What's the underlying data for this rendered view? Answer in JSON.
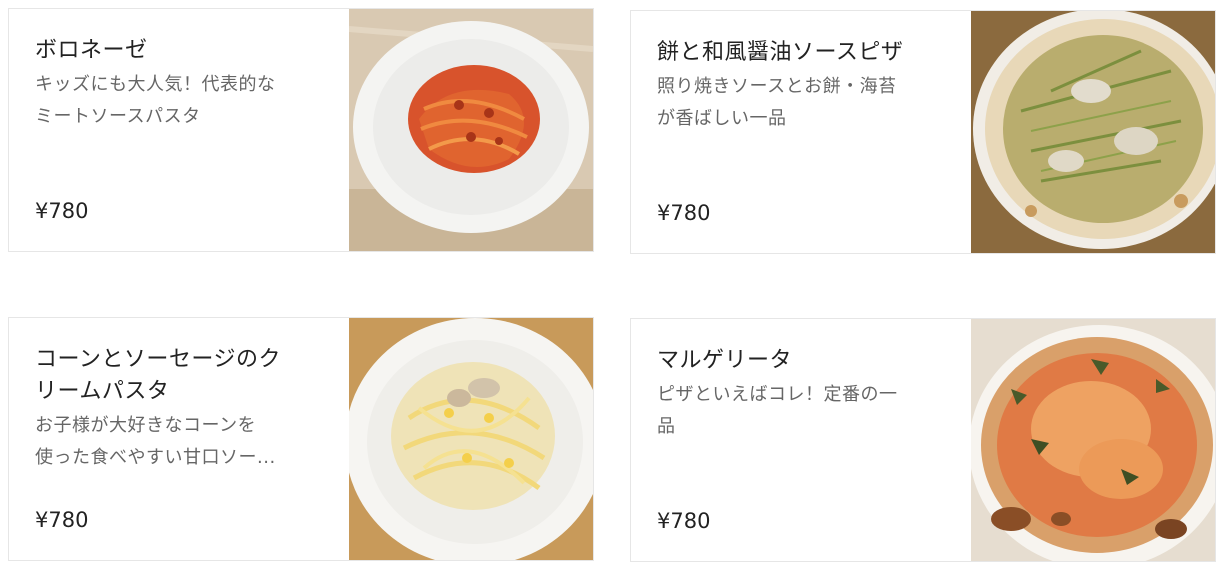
{
  "menu": {
    "items": [
      {
        "name": "ボロネーゼ",
        "desc_line1": "キッズにも大人気！代表的な",
        "desc_line2": "ミートソースパスタ",
        "price": "¥780",
        "image_icon": "bolognese-pasta-photo"
      },
      {
        "name": "餅と和風醤油ソースピザ",
        "desc_line1": "照り焼きソースとお餅・海苔",
        "desc_line2": "が香ばしい一品",
        "price": "¥780",
        "image_icon": "mochi-pizza-photo"
      },
      {
        "name_line1": "コーンとソーセージのク",
        "name_line2": "リームパスタ",
        "desc_line1": "お子様が大好きなコーンを",
        "desc_line2": "使った食べやすい甘口ソー...",
        "price": "¥780",
        "image_icon": "corn-cream-pasta-photo"
      },
      {
        "name": "マルゲリータ",
        "desc_line1": "ピザといえばコレ！定番の一",
        "desc_line2": "品",
        "price": "¥780",
        "image_icon": "margherita-pizza-photo"
      }
    ]
  }
}
